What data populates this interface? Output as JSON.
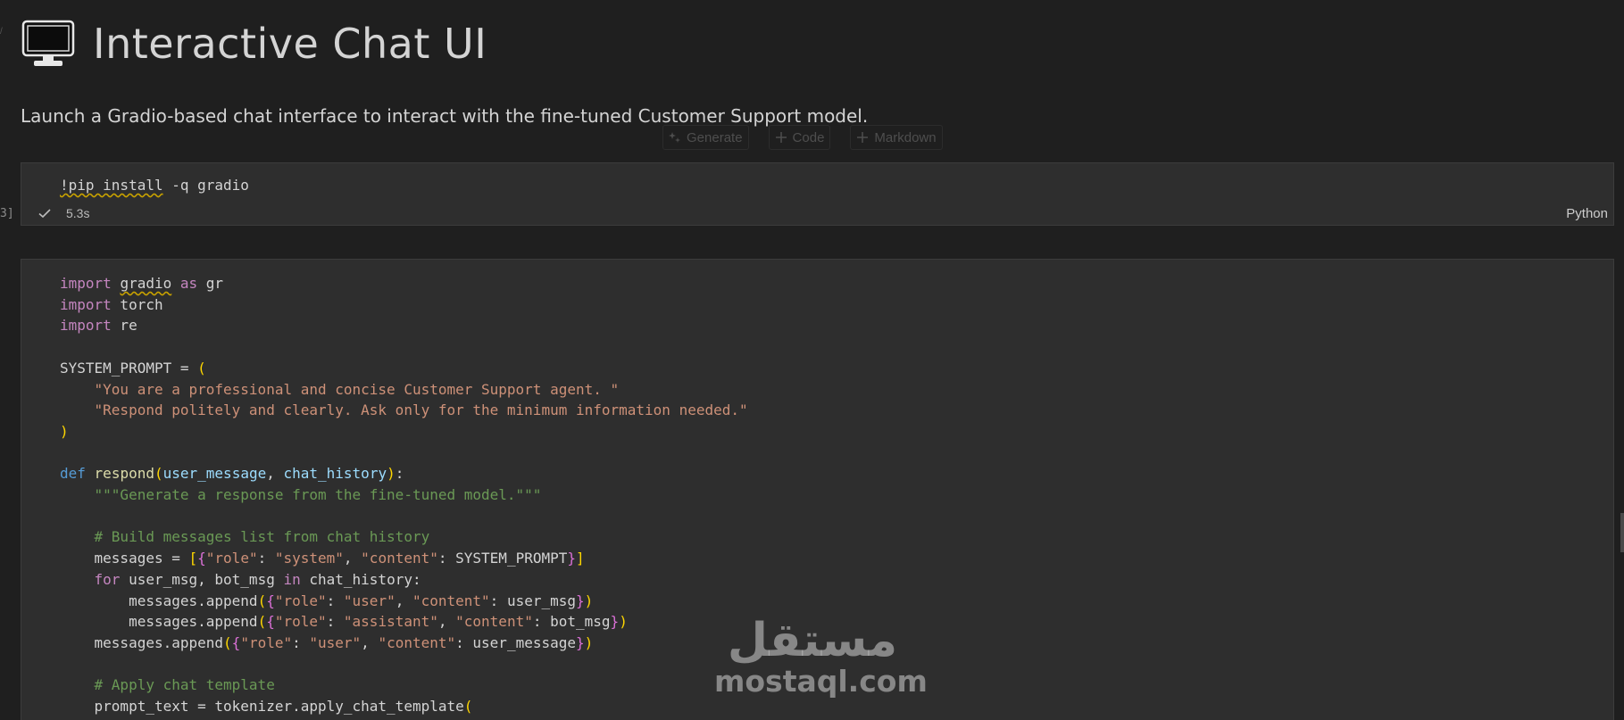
{
  "markdown": {
    "title": "Interactive Chat UI",
    "title_icon": "monitor-icon",
    "description": "Launch a Gradio-based chat interface to interact with the fine-tuned Customer Support model."
  },
  "insert_toolbar": {
    "generate_label": "Generate",
    "code_label": "Code",
    "markdown_label": "Markdown"
  },
  "cell1": {
    "execution_count": "3]",
    "code_line_1_cmd": "!pip install",
    "code_line_1_rest": " -q gradio",
    "status_icon": "check-icon",
    "duration": "5.3s",
    "language": "Python"
  },
  "cell2": {
    "lines": [
      "import gradio as gr",
      "import torch",
      "import re",
      "",
      "SYSTEM_PROMPT = (",
      "    \"You are a professional and concise Customer Support agent. \"",
      "    \"Respond politely and clearly. Ask only for the minimum information needed.\"",
      ")",
      "",
      "def respond(user_message, chat_history):",
      "    \"\"\"Generate a response from the fine-tuned model.\"\"\"",
      "",
      "    # Build messages list from chat history",
      "    messages = [{\"role\": \"system\", \"content\": SYSTEM_PROMPT}]",
      "    for user_msg, bot_msg in chat_history:",
      "        messages.append({\"role\": \"user\", \"content\": user_msg})",
      "        messages.append({\"role\": \"assistant\", \"content\": bot_msg})",
      "    messages.append({\"role\": \"user\", \"content\": user_message})",
      "",
      "    # Apply chat template",
      "    prompt_text = tokenizer.apply_chat_template("
    ]
  },
  "watermark": {
    "arabic": "مستقل",
    "latin": "mostaql.com"
  },
  "colors": {
    "background": "#1f1f1f",
    "cell_background": "#2e2e2e",
    "keyword": "#c586c0",
    "string": "#ce9178",
    "comment": "#6a9955",
    "def_keyword": "#569cd6"
  }
}
